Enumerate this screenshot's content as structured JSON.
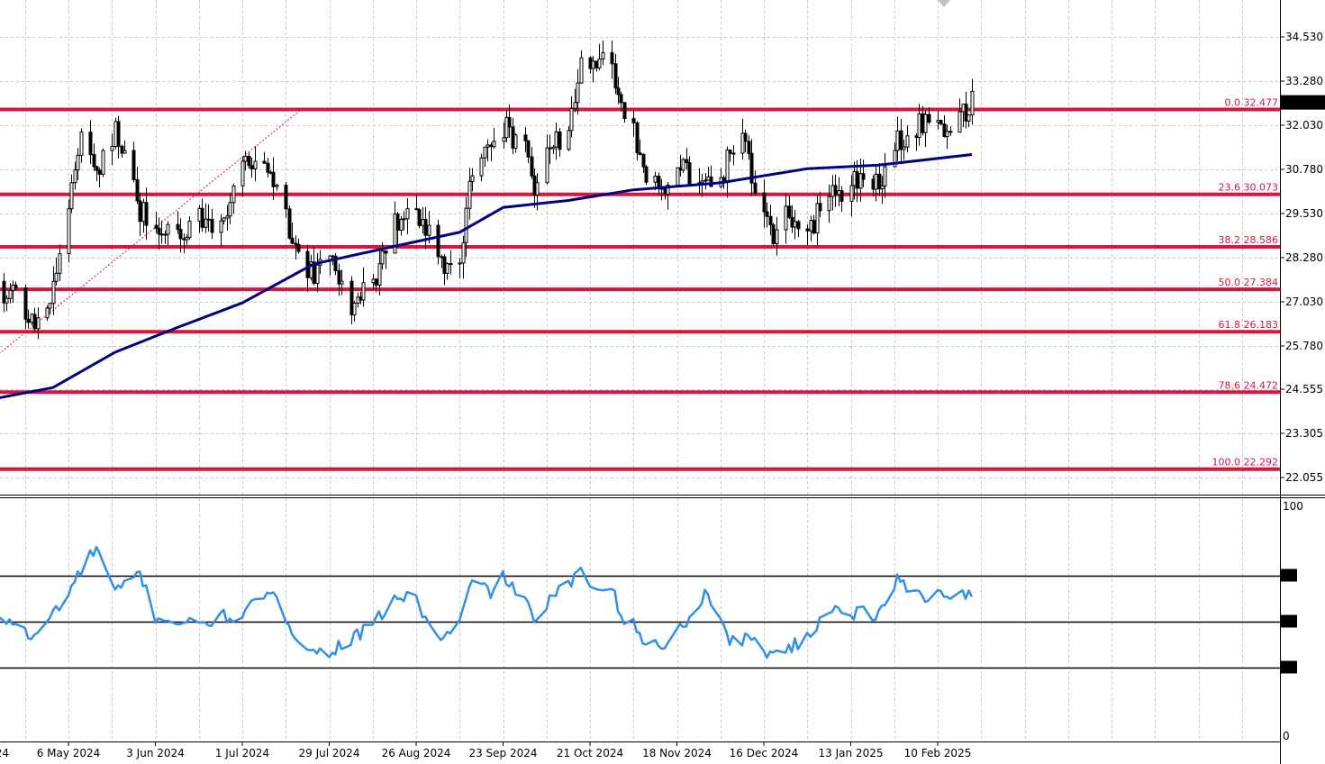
{
  "colors": {
    "fib": "#d6163f",
    "ma": "#000080",
    "rsi": "#2f8fea",
    "grid": "#c8c8c8",
    "candle": "#000000",
    "current_price_bg": "#000000",
    "current_price_fg": "#ffffff"
  },
  "chart_data": [
    {
      "type": "candlestick",
      "panel": "price",
      "title": "",
      "y_ticks": [
        "34.530",
        "33.280",
        "32.030",
        "30.780",
        "29.530",
        "28.280",
        "27.030",
        "25.780",
        "24.555",
        "23.305",
        "22.055"
      ],
      "ylim": [
        21.45,
        35.75
      ],
      "x_ticks": [
        "6 May 2024",
        "3 Jun 2024",
        "1 Jul 2024",
        "29 Jul 2024",
        "26 Aug 2024",
        "23 Sep 2024",
        "21 Oct 2024",
        "18 Nov 2024",
        "16 Dec 2024",
        "13 Jan 2025",
        "10 Feb 2025"
      ],
      "x_tick_partial": "24",
      "current_price": "32.677",
      "grid": true,
      "fibonacci_levels": [
        {
          "label": "0.0 32.477",
          "value": 32.477
        },
        {
          "label": "23.6 30.073",
          "value": 30.073
        },
        {
          "label": "38.2 28.586",
          "value": 28.586
        },
        {
          "label": "50.0 27.384",
          "value": 27.384
        },
        {
          "label": "61.8 26.183",
          "value": 26.183
        },
        {
          "label": "78.6 24.472",
          "value": 24.472
        },
        {
          "label": "100.0 22.292",
          "value": 22.292
        }
      ],
      "close_path": [
        [
          "2024-04-10",
          27.3
        ],
        [
          "2024-04-18",
          27.2
        ],
        [
          "2024-04-25",
          26.3
        ],
        [
          "2024-05-01",
          27.5
        ],
        [
          "2024-05-06",
          29.5
        ],
        [
          "2024-05-10",
          32.1
        ],
        [
          "2024-05-15",
          30.5
        ],
        [
          "2024-05-21",
          32.0
        ],
        [
          "2024-05-29",
          29.6
        ],
        [
          "2024-06-03",
          29.3
        ],
        [
          "2024-06-10",
          28.9
        ],
        [
          "2024-06-17",
          29.4
        ],
        [
          "2024-06-24",
          29.0
        ],
        [
          "2024-07-01",
          30.9
        ],
        [
          "2024-07-08",
          31.2
        ],
        [
          "2024-07-11",
          30.3
        ],
        [
          "2024-07-18",
          28.6
        ],
        [
          "2024-07-24",
          27.7
        ],
        [
          "2024-07-29",
          28.5
        ],
        [
          "2024-08-05",
          26.9
        ],
        [
          "2024-08-12",
          27.6
        ],
        [
          "2024-08-19",
          29.3
        ],
        [
          "2024-08-26",
          29.6
        ],
        [
          "2024-08-30",
          28.9
        ],
        [
          "2024-09-04",
          27.8
        ],
        [
          "2024-09-09",
          28.3
        ],
        [
          "2024-09-13",
          30.8
        ],
        [
          "2024-09-19",
          31.4
        ],
        [
          "2024-09-23",
          32.0
        ],
        [
          "2024-09-30",
          31.3
        ],
        [
          "2024-10-03",
          30.2
        ],
        [
          "2024-10-07",
          31.5
        ],
        [
          "2024-10-14",
          31.8
        ],
        [
          "2024-10-18",
          33.8
        ],
        [
          "2024-10-22",
          34.0
        ],
        [
          "2024-10-28",
          33.6
        ],
        [
          "2024-10-31",
          32.5
        ],
        [
          "2024-11-04",
          32.0
        ],
        [
          "2024-11-08",
          30.3
        ],
        [
          "2024-11-14",
          30.2
        ],
        [
          "2024-11-18",
          30.9
        ],
        [
          "2024-11-22",
          30.6
        ],
        [
          "2024-11-27",
          30.8
        ],
        [
          "2024-12-02",
          30.4
        ],
        [
          "2024-12-05",
          31.3
        ],
        [
          "2024-12-09",
          31.9
        ],
        [
          "2024-12-12",
          30.5
        ],
        [
          "2024-12-18",
          28.9
        ],
        [
          "2024-12-23",
          29.4
        ],
        [
          "2024-12-30",
          28.9
        ],
        [
          "2025-01-03",
          29.7
        ],
        [
          "2025-01-08",
          30.1
        ],
        [
          "2025-01-13",
          30.3
        ],
        [
          "2025-01-17",
          30.6
        ],
        [
          "2025-01-22",
          30.4
        ],
        [
          "2025-01-28",
          31.6
        ],
        [
          "2025-02-03",
          31.9
        ],
        [
          "2025-02-07",
          32.4
        ],
        [
          "2025-02-12",
          32.0
        ],
        [
          "2025-02-17",
          32.2
        ],
        [
          "2025-02-21",
          32.7
        ]
      ],
      "moving_average": [
        [
          "2024-04-10",
          24.25
        ],
        [
          "2024-05-01",
          24.6
        ],
        [
          "2024-05-21",
          25.6
        ],
        [
          "2024-06-10",
          26.3
        ],
        [
          "2024-07-01",
          27.0
        ],
        [
          "2024-07-24",
          28.1
        ],
        [
          "2024-08-19",
          28.6
        ],
        [
          "2024-09-09",
          29.0
        ],
        [
          "2024-09-23",
          29.7
        ],
        [
          "2024-10-14",
          29.9
        ],
        [
          "2024-11-04",
          30.2
        ],
        [
          "2024-12-02",
          30.4
        ],
        [
          "2024-12-30",
          30.8
        ],
        [
          "2025-01-22",
          30.9
        ],
        [
          "2025-02-21",
          31.2
        ]
      ],
      "trend_line": [
        [
          "2024-04-10",
          25.3
        ],
        [
          "2024-07-20",
          32.477
        ]
      ]
    },
    {
      "type": "line",
      "panel": "rsi",
      "y_ticks": [
        "100",
        "70",
        "50",
        "30",
        "0"
      ],
      "ylim": [
        0,
        100
      ],
      "levels": [
        70,
        50,
        30
      ],
      "series_path": [
        [
          "2024-04-10",
          52
        ],
        [
          "2024-04-18",
          50
        ],
        [
          "2024-04-25",
          42
        ],
        [
          "2024-04-30",
          52
        ],
        [
          "2024-05-06",
          62
        ],
        [
          "2024-05-10",
          72
        ],
        [
          "2024-05-15",
          82
        ],
        [
          "2024-05-21",
          62
        ],
        [
          "2024-05-29",
          71
        ],
        [
          "2024-06-03",
          52
        ],
        [
          "2024-06-10",
          50
        ],
        [
          "2024-06-17",
          48
        ],
        [
          "2024-06-24",
          52
        ],
        [
          "2024-07-01",
          52
        ],
        [
          "2024-07-08",
          62
        ],
        [
          "2024-07-11",
          60
        ],
        [
          "2024-07-18",
          45
        ],
        [
          "2024-07-24",
          36
        ],
        [
          "2024-07-29",
          37
        ],
        [
          "2024-08-05",
          42
        ],
        [
          "2024-08-12",
          48
        ],
        [
          "2024-08-19",
          60
        ],
        [
          "2024-08-26",
          60
        ],
        [
          "2024-08-30",
          48
        ],
        [
          "2024-09-04",
          42
        ],
        [
          "2024-09-09",
          50
        ],
        [
          "2024-09-13",
          67
        ],
        [
          "2024-09-19",
          63
        ],
        [
          "2024-09-23",
          69
        ],
        [
          "2024-09-30",
          60
        ],
        [
          "2024-10-03",
          48
        ],
        [
          "2024-10-07",
          58
        ],
        [
          "2024-10-14",
          66
        ],
        [
          "2024-10-18",
          71
        ],
        [
          "2024-10-22",
          65
        ],
        [
          "2024-10-28",
          67
        ],
        [
          "2024-10-31",
          52
        ],
        [
          "2024-11-04",
          48
        ],
        [
          "2024-11-08",
          40
        ],
        [
          "2024-11-14",
          40
        ],
        [
          "2024-11-18",
          45
        ],
        [
          "2024-11-22",
          52
        ],
        [
          "2024-11-27",
          62
        ],
        [
          "2024-12-02",
          52
        ],
        [
          "2024-12-05",
          42
        ],
        [
          "2024-12-09",
          42
        ],
        [
          "2024-12-12",
          42
        ],
        [
          "2024-12-18",
          36
        ],
        [
          "2024-12-23",
          38
        ],
        [
          "2024-12-30",
          42
        ],
        [
          "2025-01-03",
          50
        ],
        [
          "2025-01-08",
          58
        ],
        [
          "2025-01-13",
          52
        ],
        [
          "2025-01-17",
          55
        ],
        [
          "2025-01-22",
          52
        ],
        [
          "2025-01-28",
          68
        ],
        [
          "2025-02-03",
          63
        ],
        [
          "2025-02-07",
          60
        ],
        [
          "2025-02-12",
          63
        ],
        [
          "2025-02-17",
          61
        ],
        [
          "2025-02-21",
          62
        ]
      ]
    }
  ]
}
